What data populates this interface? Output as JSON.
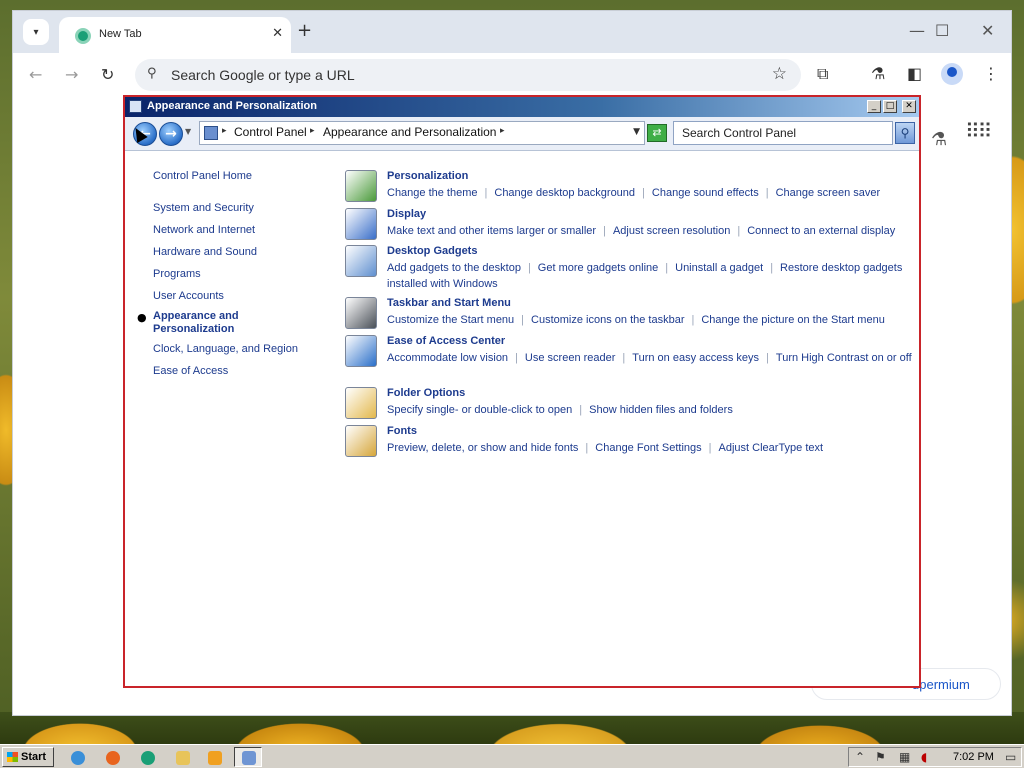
{
  "browser": {
    "tab_title": "New Tab",
    "omnibox_placeholder": "Search Google or type a URL",
    "chip_text": "upermium"
  },
  "cp_window": {
    "title": "Appearance and Personalization",
    "breadcrumb": [
      "Control Panel",
      "Appearance and Personalization"
    ],
    "search_placeholder": "Search Control Panel"
  },
  "left_nav": {
    "home": "Control Panel Home",
    "items": [
      "System and Security",
      "Network and Internet",
      "Hardware and Sound",
      "Programs",
      "User Accounts"
    ],
    "active": "Appearance and Personalization",
    "items_after": [
      "Clock, Language, and Region",
      "Ease of Access"
    ]
  },
  "categories": [
    {
      "title": "Personalization",
      "icon": "personalization-icon",
      "links": [
        "Change the theme",
        "Change desktop background",
        "Change sound effects",
        "Change screen saver"
      ]
    },
    {
      "title": "Display",
      "icon": "display-icon",
      "links": [
        "Make text and other items larger or smaller",
        "Adjust screen resolution",
        "Connect to an external display"
      ]
    },
    {
      "title": "Desktop Gadgets",
      "icon": "gadgets-icon",
      "links": [
        "Add gadgets to the desktop",
        "Get more gadgets online",
        "Uninstall a gadget",
        "Restore desktop gadgets installed with Windows"
      ]
    },
    {
      "title": "Taskbar and Start Menu",
      "icon": "taskbar-icon",
      "links": [
        "Customize the Start menu",
        "Customize icons on the taskbar",
        "Change the picture on the Start menu"
      ]
    },
    {
      "title": "Ease of Access Center",
      "icon": "ease-of-access-icon",
      "links": [
        "Accommodate low vision",
        "Use screen reader",
        "Turn on easy access keys",
        "Turn High Contrast on or off"
      ]
    },
    {
      "title": "Folder Options",
      "icon": "folder-options-icon",
      "links": [
        "Specify single- or double-click to open",
        "Show hidden files and folders"
      ]
    },
    {
      "title": "Fonts",
      "icon": "fonts-icon",
      "links": [
        "Preview, delete, or show and hide fonts",
        "Change Font Settings",
        "Adjust ClearType text"
      ]
    }
  ],
  "taskbar": {
    "start_label": "Start",
    "clock": "7:02 PM"
  },
  "colors": {
    "link": "#1d3b8e",
    "title_bar_start": "#0a246a",
    "window_border": "#c9242a"
  }
}
